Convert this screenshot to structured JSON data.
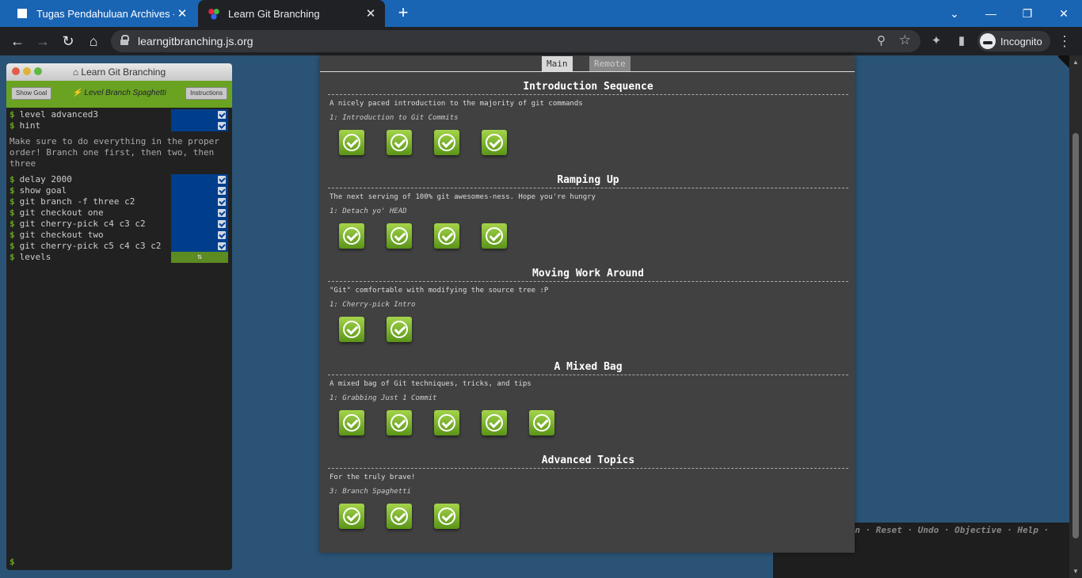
{
  "browser": {
    "tabs": [
      {
        "title": "Tugas Pendahuluan Archives - In"
      },
      {
        "title": "Learn Git Branching"
      }
    ],
    "url": "learngitbranching.js.org",
    "incognito_label": "Incognito"
  },
  "terminal": {
    "title": "Learn Git Branching",
    "show_goal": "Show Goal",
    "level_label": "Level Branch Spaghetti",
    "instructions": "Instructions",
    "commands_top": [
      {
        "text": "level advanced3"
      },
      {
        "text": "hint"
      }
    ],
    "hint_text": "Make sure to do everything in the proper order! Branch one first, then two, then three",
    "commands": [
      {
        "text": "delay 2000"
      },
      {
        "text": "show goal"
      },
      {
        "text": "git branch -f three c2"
      },
      {
        "text": "git checkout one"
      },
      {
        "text": "git cherry-pick c4 c3 c2"
      },
      {
        "text": "git checkout two"
      },
      {
        "text": "git cherry-pick c5 c4 c3 c2"
      }
    ],
    "last_command": "levels",
    "prompt": "$"
  },
  "right_menu": "ion · Reset · Undo · Objective · Help · ",
  "dialog": {
    "tab_main": "Main",
    "tab_remote": "Remote",
    "sequences": [
      {
        "title": "Introduction Sequence",
        "about": "A nicely paced introduction to the majority of git commands",
        "current": "1: Introduction to Git Commits",
        "count": 4
      },
      {
        "title": "Ramping Up",
        "about": "The next serving of 100% git awesomes-ness. Hope you're hungry",
        "current": "1: Detach yo' HEAD",
        "count": 4
      },
      {
        "title": "Moving Work Around",
        "about": "\"Git\" comfortable with modifying the source tree :P",
        "current": "1: Cherry-pick Intro",
        "count": 2
      },
      {
        "title": "A Mixed Bag",
        "about": "A mixed bag of Git techniques, tricks, and tips",
        "current": "1: Grabbing Just 1 Commit",
        "count": 5
      },
      {
        "title": "Advanced Topics",
        "about": "For the truly brave!",
        "current": "3: Branch Spaghetti",
        "count": 3
      }
    ]
  }
}
